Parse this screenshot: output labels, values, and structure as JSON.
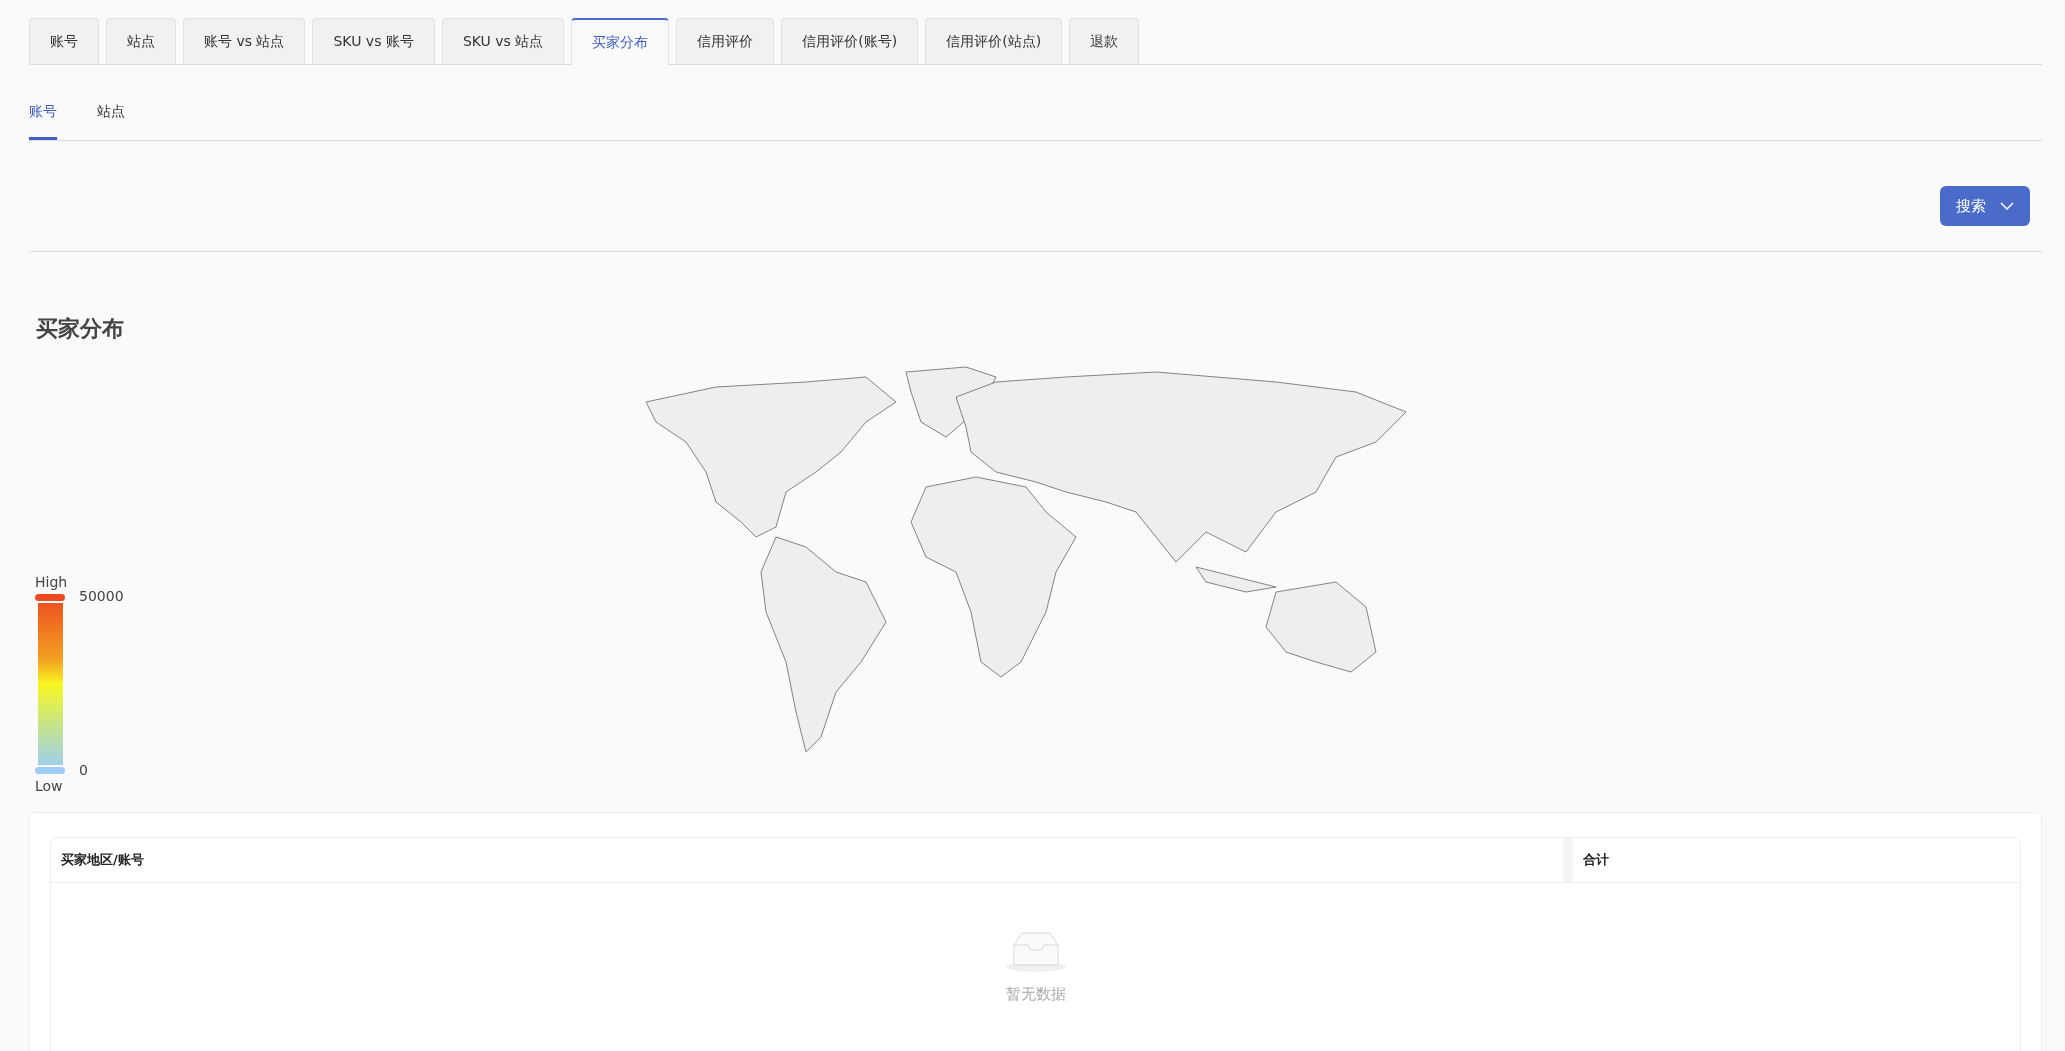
{
  "tabs": [
    {
      "label": "账号",
      "selected": false
    },
    {
      "label": "站点",
      "selected": false
    },
    {
      "label": "账号 vs 站点",
      "selected": false
    },
    {
      "label": "SKU vs 账号",
      "selected": false
    },
    {
      "label": "SKU vs 站点",
      "selected": false
    },
    {
      "label": "买家分布",
      "selected": true
    },
    {
      "label": "信用评价",
      "selected": false
    },
    {
      "label": "信用评价(账号)",
      "selected": false
    },
    {
      "label": "信用评价(站点)",
      "selected": false
    },
    {
      "label": "退款",
      "selected": false
    }
  ],
  "sub_tabs": [
    {
      "label": "账号",
      "selected": true
    },
    {
      "label": "站点",
      "selected": false
    }
  ],
  "search_button": "搜索",
  "chart": {
    "title": "买家分布",
    "legend": {
      "high_label": "High",
      "max": "50000",
      "min": "0",
      "low_label": "Low"
    }
  },
  "table": {
    "columns": [
      "买家地区/账号",
      "合计"
    ],
    "empty_text": "暂无数据"
  }
}
